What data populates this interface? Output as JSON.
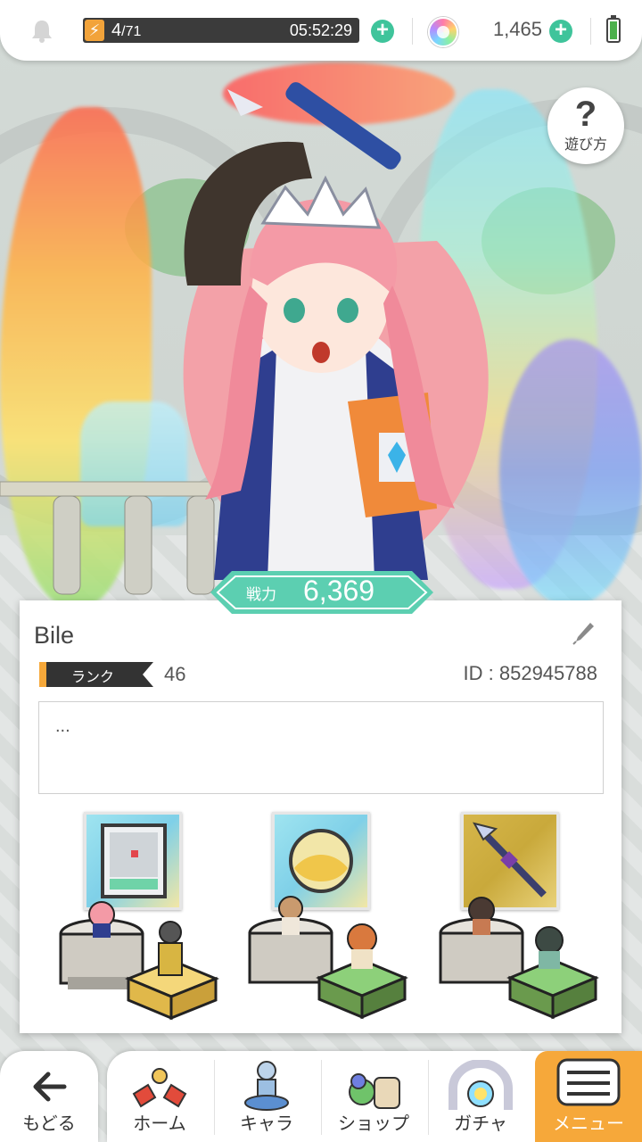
{
  "status_bar": {
    "stamina_current": "4",
    "stamina_max": "/71",
    "stamina_timer": "05:52:29",
    "gems": "1,465",
    "plus_symbol": "+"
  },
  "help": {
    "symbol": "?",
    "label": "遊び方"
  },
  "profile": {
    "power_label": "戦力",
    "power_value": "6,369",
    "name": "Bile",
    "rank_label": "ランク",
    "rank_value": "46",
    "id_text": "ID : 852945788",
    "comment": "..."
  },
  "nav": {
    "back": "もどる",
    "home": "ホーム",
    "chara": "キャラ",
    "shop": "ショップ",
    "gacha": "ガチャ",
    "menu": "メニュー"
  },
  "colors": {
    "accent_teal": "#5ccfb1",
    "accent_orange": "#f6a83a",
    "plus_green": "#3fc49b"
  }
}
